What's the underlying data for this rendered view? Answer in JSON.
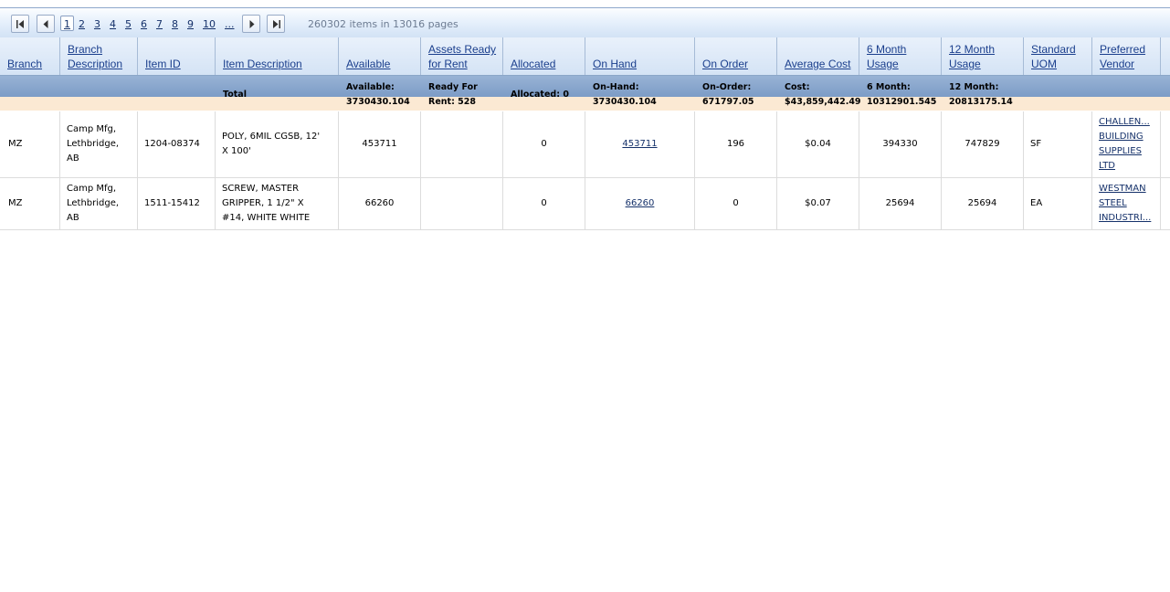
{
  "pager": {
    "pages": [
      "1",
      "2",
      "3",
      "4",
      "5",
      "6",
      "7",
      "8",
      "9",
      "10",
      "..."
    ],
    "current": "1",
    "info": "260302 items in 13016 pages"
  },
  "columns": [
    {
      "key": "branch",
      "lines": [
        "Branch"
      ]
    },
    {
      "key": "branch_desc",
      "lines": [
        "Branch",
        "Description"
      ]
    },
    {
      "key": "item_id",
      "lines": [
        "Item ID"
      ]
    },
    {
      "key": "item_desc",
      "lines": [
        "Item Description"
      ]
    },
    {
      "key": "available",
      "lines": [
        "Available"
      ]
    },
    {
      "key": "assets",
      "lines": [
        "Assets Ready",
        "for Rent"
      ]
    },
    {
      "key": "allocated",
      "lines": [
        "Allocated"
      ]
    },
    {
      "key": "on_hand",
      "lines": [
        "On Hand"
      ]
    },
    {
      "key": "on_order",
      "lines": [
        "On Order"
      ]
    },
    {
      "key": "avg_cost",
      "lines": [
        "Average Cost"
      ]
    },
    {
      "key": "usage6",
      "lines": [
        "6 Month",
        "Usage"
      ]
    },
    {
      "key": "usage12",
      "lines": [
        "12 Month",
        "Usage"
      ]
    },
    {
      "key": "uom",
      "lines": [
        "Standard",
        "UOM"
      ]
    },
    {
      "key": "vendor",
      "lines": [
        "Preferred",
        "Vendor"
      ]
    }
  ],
  "totals": {
    "label": "Total",
    "available": [
      "Available:",
      "3730430.104"
    ],
    "assets": [
      "Ready For",
      "Rent: 528"
    ],
    "allocated": "Allocated: 0",
    "on_hand": [
      "On-Hand:",
      "3730430.104"
    ],
    "on_order": [
      "On-Order:",
      "671797.05"
    ],
    "avg_cost": [
      "Cost:",
      "$43,859,442.49"
    ],
    "usage6": [
      "6 Month:",
      "10312901.545"
    ],
    "usage12": [
      "12 Month:",
      "20813175.14"
    ]
  },
  "rows": [
    {
      "branch": "MZ",
      "branch_desc": [
        "Camp Mfg,",
        "Lethbridge,",
        "AB"
      ],
      "item_id": "1204-08374",
      "item_desc": [
        "POLY, 6MIL CGSB, 12'",
        "X 100'"
      ],
      "available": "453711",
      "assets": "",
      "allocated": "0",
      "on_hand": "453711",
      "on_order": "196",
      "avg_cost": "$0.04",
      "usage6": "394330",
      "usage12": "747829",
      "uom": "SF",
      "vendor": [
        "CHALLEN...",
        "BUILDING",
        "SUPPLIES",
        "LTD"
      ]
    },
    {
      "branch": "MZ",
      "branch_desc": [
        "Camp Mfg,",
        "Lethbridge,",
        "AB"
      ],
      "item_id": "1511-15412",
      "item_desc": [
        "SCREW, MASTER",
        "GRIPPER, 1 1/2\" X",
        "#14, WHITE WHITE"
      ],
      "available": "66260",
      "assets": "",
      "allocated": "0",
      "on_hand": "66260",
      "on_order": "0",
      "avg_cost": "$0.07",
      "usage6": "25694",
      "usage12": "25694",
      "uom": "EA",
      "vendor": [
        "WESTMAN",
        "STEEL",
        "INDUSTRI..."
      ]
    }
  ],
  "colors": {
    "link": "#15316a",
    "header_link": "#1b3f8d",
    "totals_band": "#fbe9d3"
  }
}
